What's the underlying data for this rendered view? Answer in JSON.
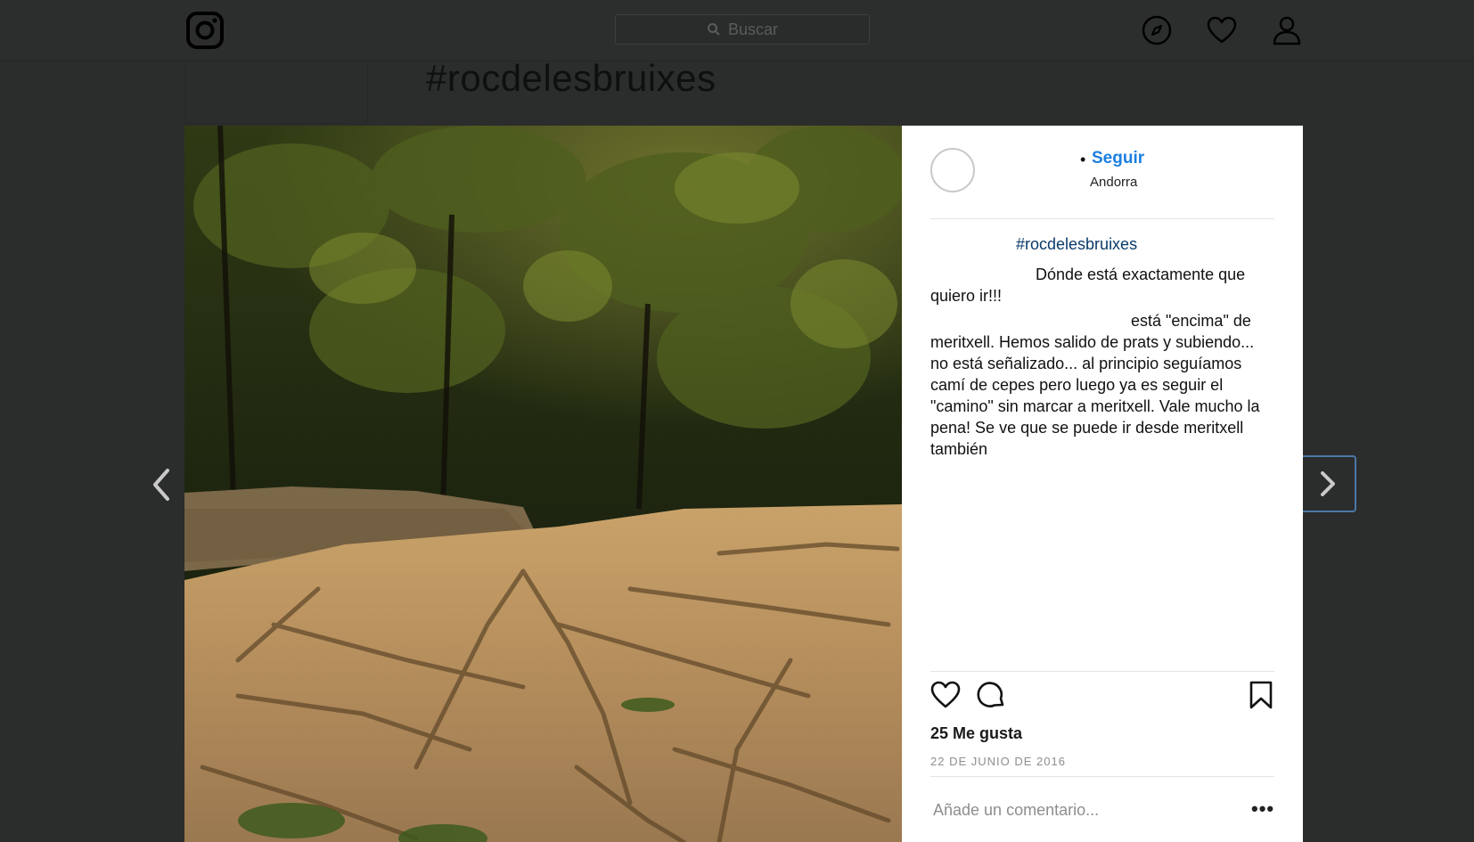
{
  "header": {
    "search_placeholder": "Buscar",
    "logo_icon": "instagram-logo-icon",
    "nav_icons": [
      "compass-icon",
      "heart-icon",
      "user-icon"
    ]
  },
  "background": {
    "hashtag_title": "#rocdelesbruixes"
  },
  "post": {
    "follow_label": "Seguir",
    "location": "Andorra",
    "hashtag": "#rocdelesbruixes",
    "caption_line1": "Dónde está exactamente que quiero ir!!!",
    "caption_body": "está \"encima\" de meritxell. Hemos salido de prats y subiendo... no está señalizado... al principio seguíamos camí de cepes pero luego ya es seguir el \"camino\" sin marcar a meritxell. Vale mucho la pena! Se ve que se puede ir desde meritxell también",
    "likes": "25 Me gusta",
    "date": "22 DE JUNIO DE 2016",
    "comment_placeholder": "Añade un comentario...",
    "more_label": "•••"
  },
  "colors": {
    "overlay_bg": "#2b2c2c",
    "link_blue": "#1c7fe0",
    "hashtag_blue": "#0b3a69"
  }
}
